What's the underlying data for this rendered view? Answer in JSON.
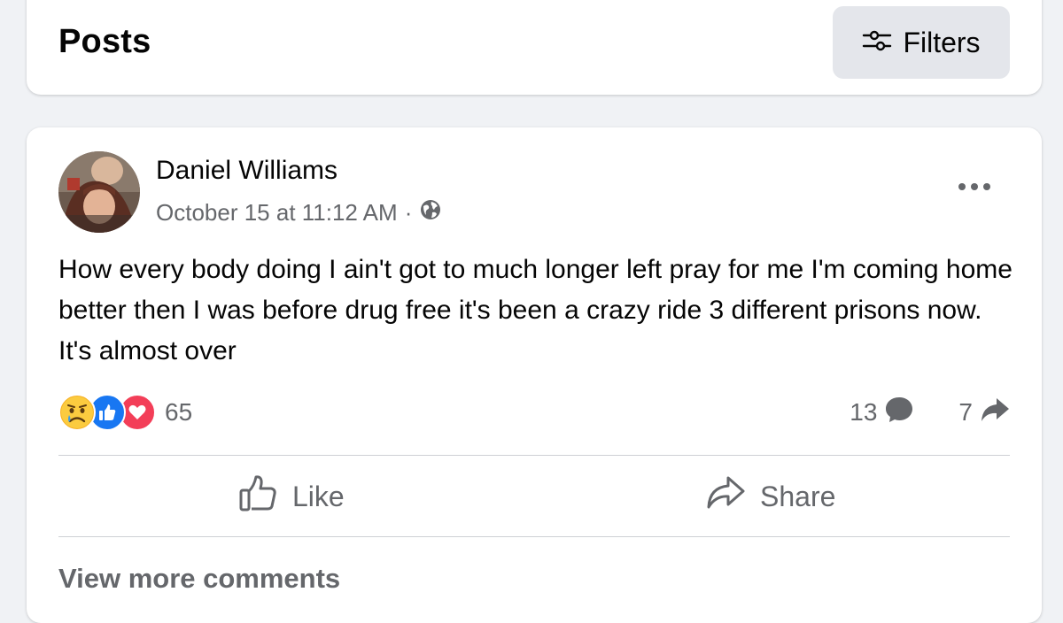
{
  "header": {
    "title": "Posts",
    "filters_label": "Filters"
  },
  "post": {
    "author": "Daniel Williams",
    "timestamp": "October 15 at 11:12 AM",
    "separator": "·",
    "privacy_icon": "globe-icon",
    "text": "How every body doing I ain't got to much longer left pray for me I'm coming home better then I was before drug free it's been a crazy ride 3 different prisons now. It's almost over",
    "reactions": {
      "icons": [
        "sad-reaction-icon",
        "like-reaction-icon",
        "love-reaction-icon"
      ],
      "count": "65"
    },
    "comments_count": "13",
    "shares_count": "7",
    "actions": {
      "like_label": "Like",
      "share_label": "Share"
    },
    "view_more_label": "View more comments"
  },
  "colors": {
    "background": "#f0f2f5",
    "card": "#ffffff",
    "secondary_text": "#65676b",
    "like_blue": "#1877f2",
    "love_red": "#f33e58",
    "sad_yellow": "#f7b125"
  }
}
